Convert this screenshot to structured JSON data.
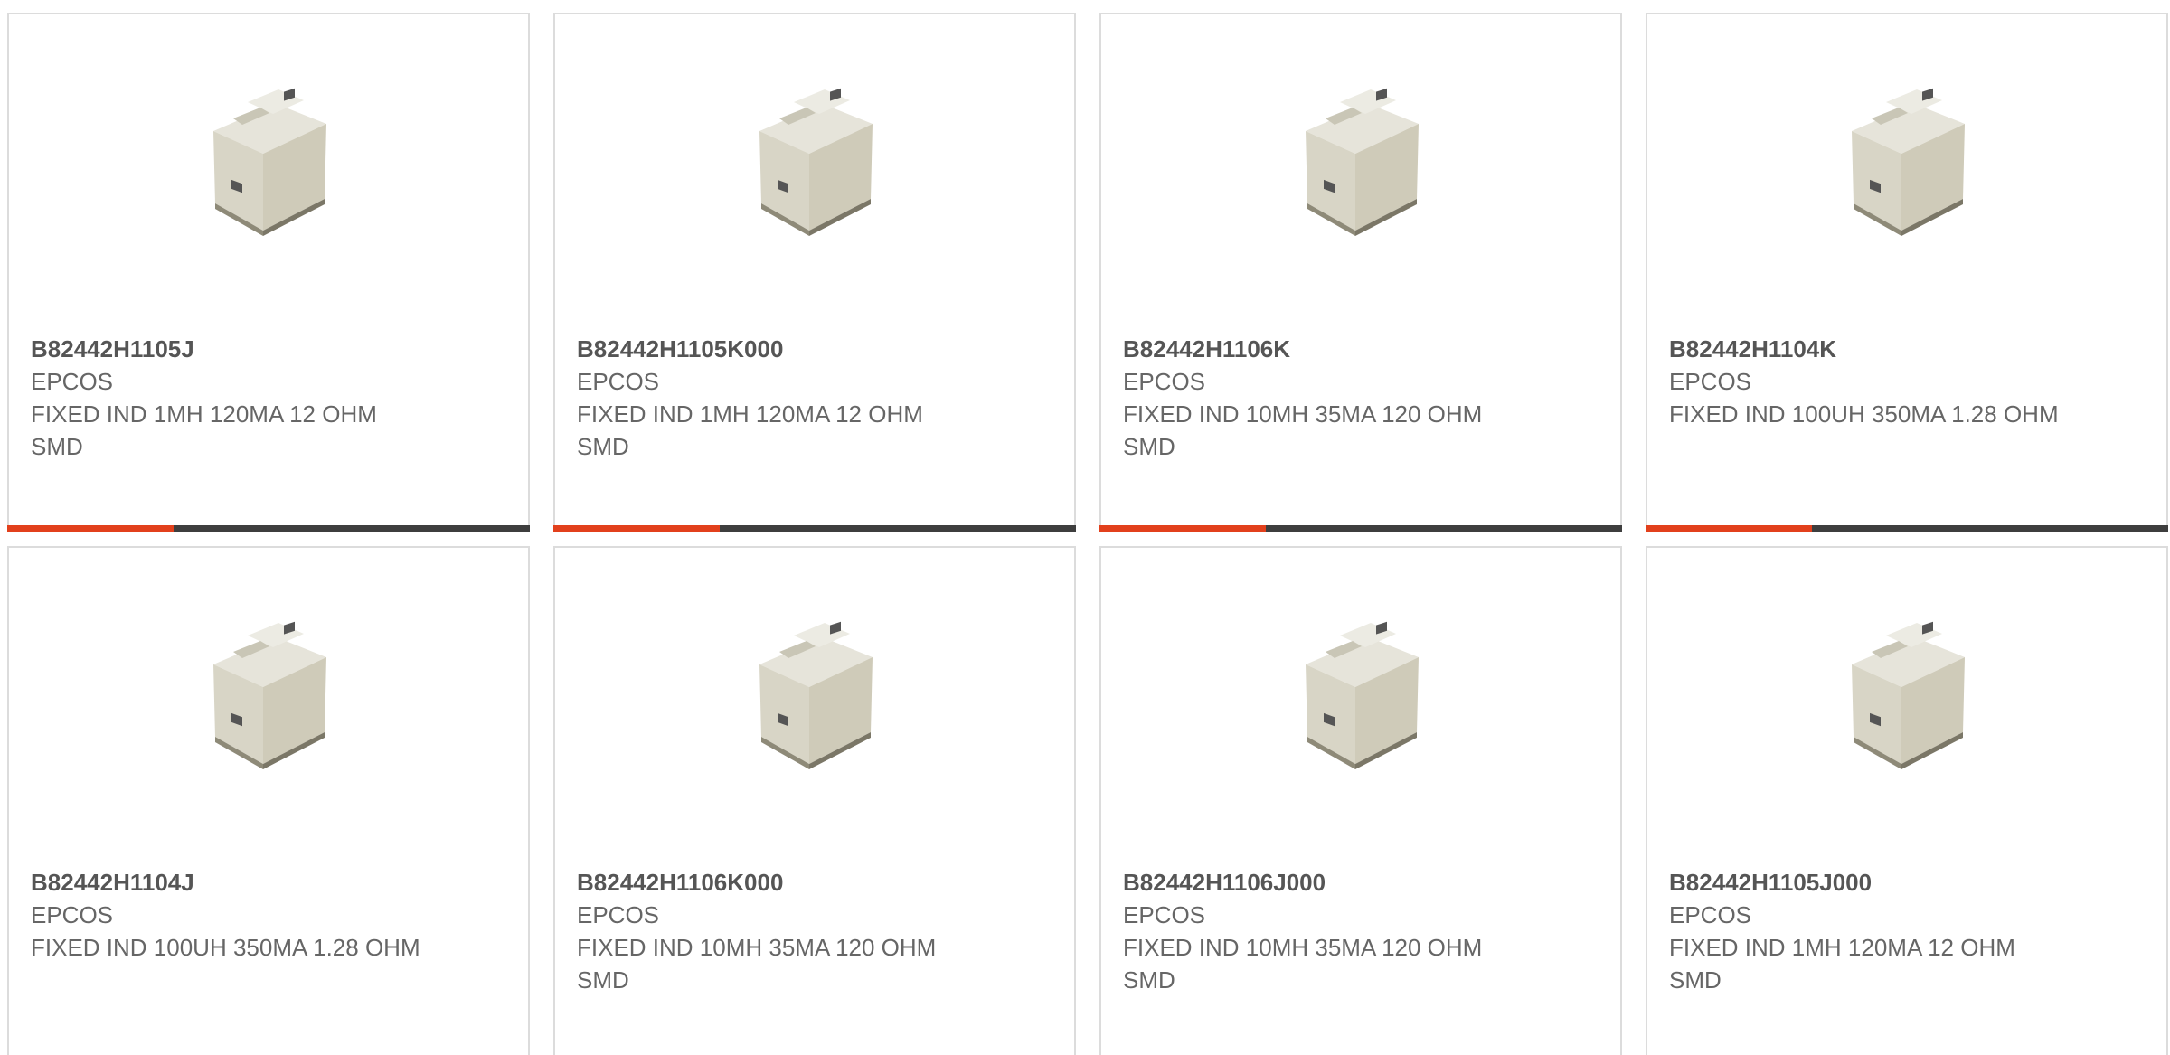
{
  "colors": {
    "accent": "#e2401c",
    "bar": "#3e3e3e",
    "border": "#dcdcdc",
    "text": "#666666"
  },
  "products": [
    {
      "part_number": "B82442H1105J",
      "manufacturer": "EPCOS",
      "description": "FIXED IND 1MH 120MA 12 OHM SMD",
      "image_icon": "smd-inductor-image"
    },
    {
      "part_number": "B82442H1105K000",
      "manufacturer": "EPCOS",
      "description": "FIXED IND 1MH 120MA 12 OHM SMD",
      "image_icon": "smd-inductor-image"
    },
    {
      "part_number": "B82442H1106K",
      "manufacturer": "EPCOS",
      "description": "FIXED IND 10MH 35MA 120 OHM SMD",
      "image_icon": "smd-inductor-image"
    },
    {
      "part_number": "B82442H1104K",
      "manufacturer": "EPCOS",
      "description": "FIXED IND 100UH 350MA 1.28 OHM",
      "image_icon": "smd-inductor-image"
    },
    {
      "part_number": "B82442H1104J",
      "manufacturer": "EPCOS",
      "description": "FIXED IND 100UH 350MA 1.28 OHM",
      "image_icon": "smd-inductor-image"
    },
    {
      "part_number": "B82442H1106K000",
      "manufacturer": "EPCOS",
      "description": "FIXED IND 10MH 35MA 120 OHM SMD",
      "image_icon": "smd-inductor-image"
    },
    {
      "part_number": "B82442H1106J000",
      "manufacturer": "EPCOS",
      "description": "FIXED IND 10MH 35MA 120 OHM SMD",
      "image_icon": "smd-inductor-image"
    },
    {
      "part_number": "B82442H1105J000",
      "manufacturer": "EPCOS",
      "description": "FIXED IND 1MH 120MA 12 OHM SMD",
      "image_icon": "smd-inductor-image"
    }
  ]
}
